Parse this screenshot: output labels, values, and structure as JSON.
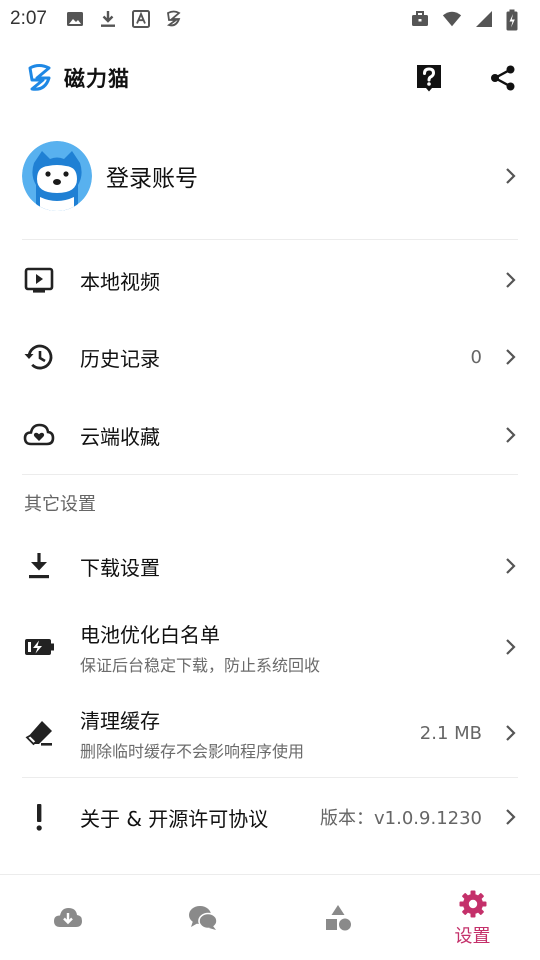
{
  "status_bar": {
    "time": "2:07",
    "left_icons": [
      "image-icon",
      "download-icon",
      "text-icon",
      "app-logo-icon"
    ],
    "right_icons": [
      "work-profile-icon",
      "wifi-icon",
      "signal-icon",
      "battery-charging-icon"
    ]
  },
  "app_bar": {
    "title": "磁力猫",
    "actions": [
      "help-icon",
      "share-icon"
    ]
  },
  "account": {
    "label": "登录账号"
  },
  "menu_main": [
    {
      "icon": "video-library-icon",
      "title": "本地视频",
      "value": ""
    },
    {
      "icon": "history-icon",
      "title": "历史记录",
      "value": "0"
    },
    {
      "icon": "cloud-favorite-icon",
      "title": "云端收藏",
      "value": ""
    }
  ],
  "section_other": "其它设置",
  "menu_other": [
    {
      "icon": "download-icon",
      "title": "下载设置",
      "subtitle": "",
      "value": ""
    },
    {
      "icon": "battery-icon",
      "title": "电池优化白名单",
      "subtitle": "保证后台稳定下载，防止系统回收",
      "value": ""
    },
    {
      "icon": "eraser-icon",
      "title": "清理缓存",
      "subtitle": "删除临时缓存不会影响程序使用",
      "value": "2.1 MB"
    },
    {
      "icon": "exclamation-icon",
      "title": "关于 & 开源许可协议",
      "subtitle": "",
      "value": "版本：v1.0.9.1230"
    }
  ],
  "bottom_nav": {
    "items": [
      {
        "icon": "cloud-download-icon",
        "label": ""
      },
      {
        "icon": "chat-icon",
        "label": ""
      },
      {
        "icon": "shapes-icon",
        "label": ""
      },
      {
        "icon": "settings-gear-icon",
        "label": "设置"
      }
    ],
    "active_index": 3
  },
  "colors": {
    "accent": "#c4306a",
    "brand_blue": "#1e88e5",
    "icon_dark": "#222222",
    "icon_grey": "#8a8a8a"
  }
}
